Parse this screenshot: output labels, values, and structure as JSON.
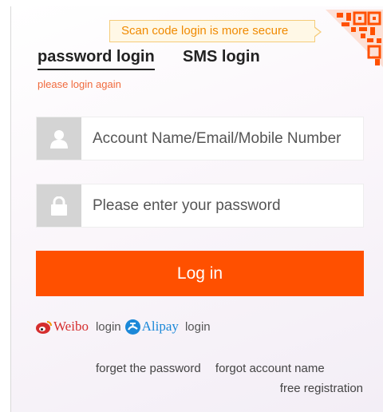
{
  "tooltip": {
    "text": "Scan code login is more secure"
  },
  "tabs": [
    {
      "label": "password login",
      "active": true
    },
    {
      "label": "SMS login",
      "active": false
    }
  ],
  "notice": "please login again",
  "account": {
    "placeholder": "Account Name/Email/Mobile Number",
    "icon": "user-icon"
  },
  "password": {
    "placeholder": "Please enter your password",
    "icon": "lock-icon"
  },
  "login_button": "Log in",
  "third_party": {
    "weibo": {
      "brand": "Weibo",
      "action": "login",
      "icon": "weibo-icon"
    },
    "alipay": {
      "brand": "Alipay",
      "action": "login",
      "icon": "alipay-icon"
    }
  },
  "links": {
    "forget_password": "forget the password",
    "forgot_account": "forgot account name",
    "register": "free registration"
  },
  "colors": {
    "accent": "#ff5000",
    "notice": "#f06a3c",
    "tooltip_text": "#f08a00"
  }
}
